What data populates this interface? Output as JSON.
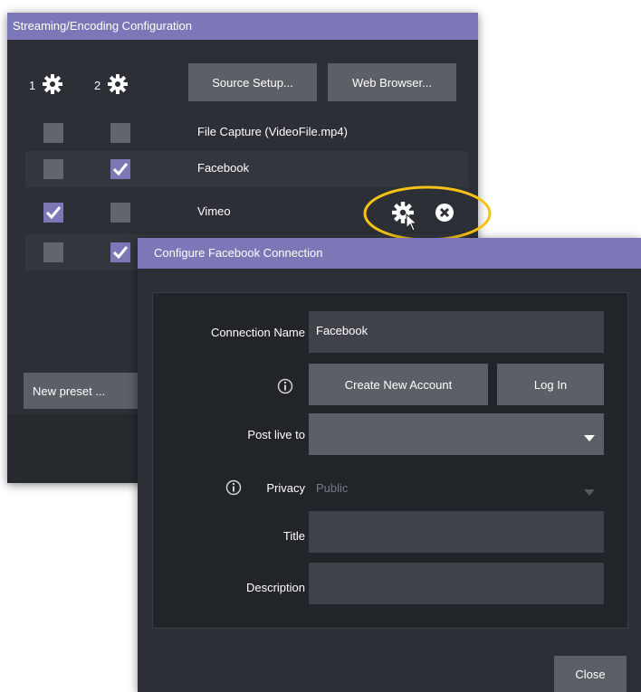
{
  "streaming_window": {
    "title": "Streaming/Encoding Configuration",
    "gear1_label": "1",
    "gear2_label": "2",
    "source_setup_label": "Source Setup...",
    "web_browser_label": "Web Browser...",
    "rows": [
      {
        "label": "File Capture (VideoFile.mp4)",
        "col1_checked": false,
        "col2_checked": false
      },
      {
        "label": "Facebook",
        "col1_checked": false,
        "col2_checked": true
      },
      {
        "label": "Vimeo",
        "col1_checked": true,
        "col2_checked": false
      },
      {
        "label": "",
        "col1_checked": false,
        "col2_checked": true
      }
    ],
    "new_preset_label": "New preset ...",
    "highlight_color": "#f5c215"
  },
  "facebook_dialog": {
    "title": "Configure Facebook Connection",
    "connection_name_label": "Connection Name",
    "connection_name_value": "Facebook",
    "create_account_label": "Create New Account",
    "login_label": "Log In",
    "post_live_to_label": "Post live to",
    "post_live_to_value": "",
    "privacy_label": "Privacy",
    "privacy_value": "Public",
    "title_label": "Title",
    "title_value": "",
    "description_label": "Description",
    "description_value": "",
    "close_label": "Close"
  },
  "colors": {
    "accent": "#7c78b7",
    "window_bg": "#2c3036",
    "button_bg": "#5b5f66",
    "field_bg": "#3f4349"
  }
}
